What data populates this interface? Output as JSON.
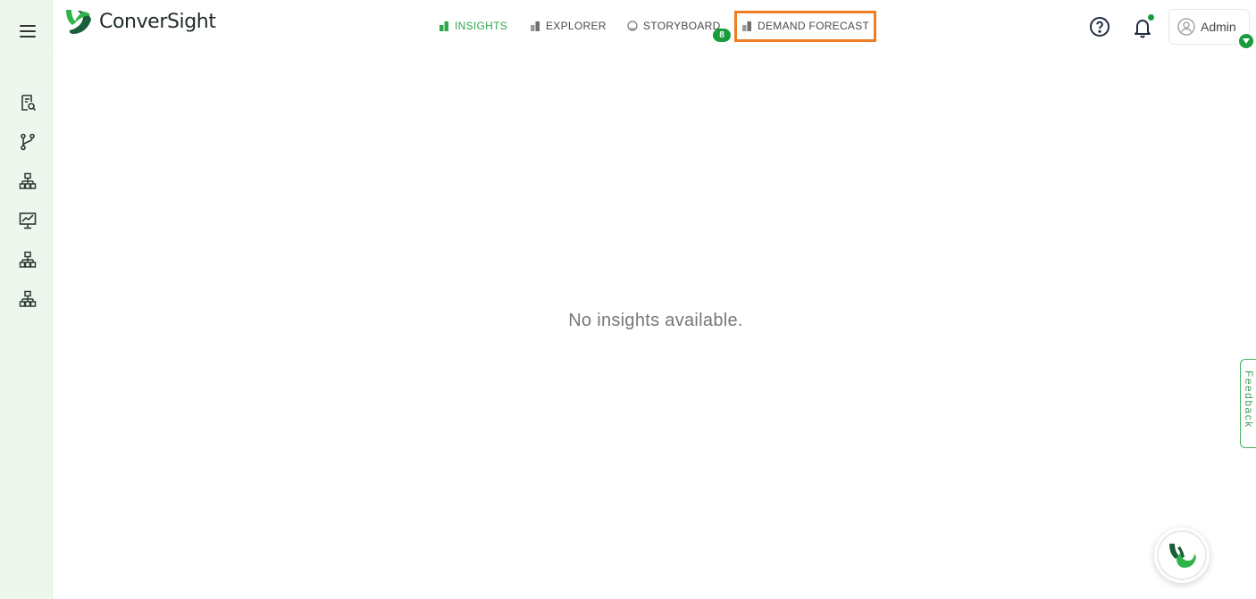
{
  "brand": {
    "name": "ConverSight",
    "logo_colors": {
      "dark": "#1b5e3a",
      "light": "#2fb44a"
    }
  },
  "sidebar": {
    "menu_icon": "hamburger-menu-icon",
    "items": [
      {
        "icon": "report-search-icon"
      },
      {
        "icon": "branch-icon"
      },
      {
        "icon": "hierarchy-icon"
      },
      {
        "icon": "presentation-chart-icon"
      },
      {
        "icon": "hierarchy-icon"
      },
      {
        "icon": "hierarchy-icon"
      }
    ]
  },
  "nav": {
    "tabs": [
      {
        "label": "INSIGHTS",
        "icon": "bar-chart-icon",
        "active": true
      },
      {
        "label": "EXPLORER",
        "icon": "bar-chart-icon",
        "active": false
      },
      {
        "label": "STORYBOARD",
        "icon": "globe-icon",
        "active": false,
        "badge": "8"
      },
      {
        "label": "DEMAND FORECAST",
        "icon": "bar-chart-icon",
        "active": false,
        "highlighted": true
      }
    ]
  },
  "header": {
    "help_icon": "help-circle-icon",
    "notification_icon": "bell-icon",
    "user": {
      "label": "Admin",
      "icon": "user-avatar-icon"
    }
  },
  "main": {
    "empty_message": "No insights available."
  },
  "feedback": {
    "label": "Feedback"
  },
  "chat": {
    "icon": "conversight-assistant-icon"
  },
  "colors": {
    "accent": "#2ea84a",
    "badge": "#1a9c3e",
    "highlight": "#f07d24",
    "sidebar_bg": "#eef7ee"
  }
}
